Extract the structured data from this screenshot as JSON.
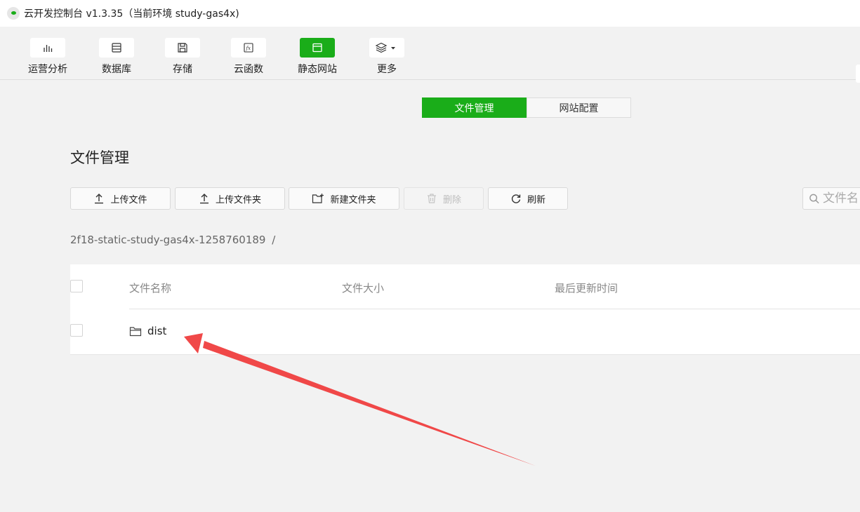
{
  "window": {
    "title": "云开发控制台 v1.3.35（当前环境 study-gas4x)"
  },
  "toolbar": {
    "items": [
      {
        "label": "运营分析",
        "icon": "bar-chart-icon"
      },
      {
        "label": "数据库",
        "icon": "database-icon"
      },
      {
        "label": "存储",
        "icon": "storage-icon"
      },
      {
        "label": "云函数",
        "icon": "function-icon"
      },
      {
        "label": "静态网站",
        "icon": "website-icon",
        "active": true
      },
      {
        "label": "更多",
        "icon": "layers-icon"
      }
    ]
  },
  "tabs": {
    "file_manage": "文件管理",
    "site_config": "网站配置",
    "active": "文件管理"
  },
  "section": {
    "title": "文件管理"
  },
  "actions": {
    "upload_file": "上传文件",
    "upload_folder": "上传文件夹",
    "new_folder": "新建文件夹",
    "delete": "删除",
    "refresh": "刷新"
  },
  "search": {
    "placeholder": "文件名"
  },
  "breadcrumb": {
    "path": "2f18-static-study-gas4x-1258760189",
    "separator": "/"
  },
  "table": {
    "columns": [
      "文件名称",
      "文件大小",
      "最后更新时间"
    ],
    "rows": [
      {
        "name": "dist",
        "type": "folder",
        "size": "",
        "updated": ""
      }
    ]
  },
  "colors": {
    "accent": "#1aad19",
    "annotation_arrow": "#f04848"
  }
}
